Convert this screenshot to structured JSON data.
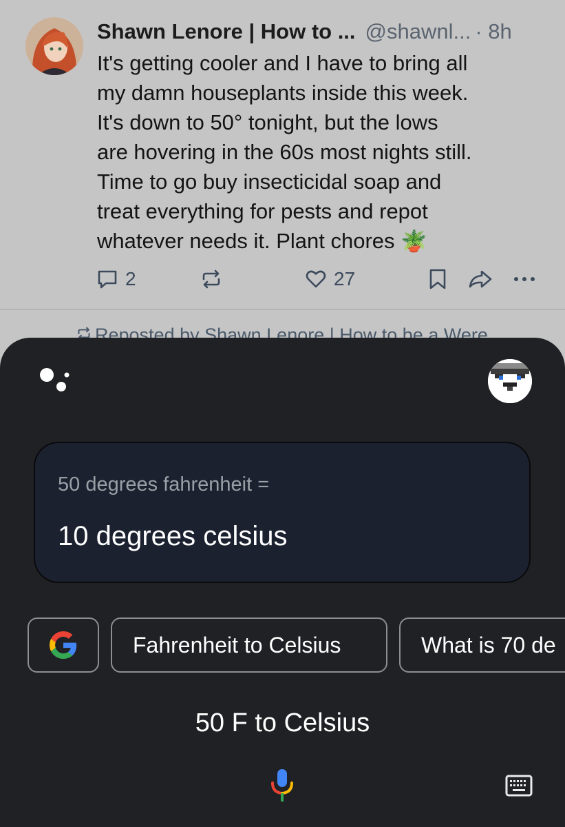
{
  "post": {
    "author": "Shawn Lenore | How to ...",
    "handle": "@shawnl...",
    "time": "8h",
    "body_lines": [
      "It's getting cooler and I have to bring all",
      "my damn houseplants inside this week.",
      "It's down to 50° tonight, but the lows",
      "are hovering in the 60s most nights still.",
      "Time to go buy insecticidal soap and",
      "treat everything for pests and repot",
      "whatever needs it. Plant chores 🪴"
    ],
    "reply_count": "2",
    "like_count": "27",
    "repost_banner": "Reposted by Shawn Lenore | How to be a Were..."
  },
  "assistant": {
    "question": "50 degrees fahrenheit =",
    "result": "10 degrees celsius",
    "chips": [
      "Fahrenheit to Celsius",
      "What is 70 de"
    ],
    "query": "50 F to Celsius"
  },
  "colors": {
    "sheet_bg": "#202124",
    "card_bg": "#1c2130",
    "google_blue": "#4285F4",
    "google_red": "#EA4335",
    "google_yellow": "#FBBC05",
    "google_green": "#34A853"
  },
  "icons": [
    "reply-icon",
    "repost-icon",
    "like-icon",
    "bookmark-icon",
    "share-icon",
    "more-icon",
    "assistant-logo-icon",
    "google-g-icon",
    "mic-icon",
    "keyboard-icon"
  ]
}
